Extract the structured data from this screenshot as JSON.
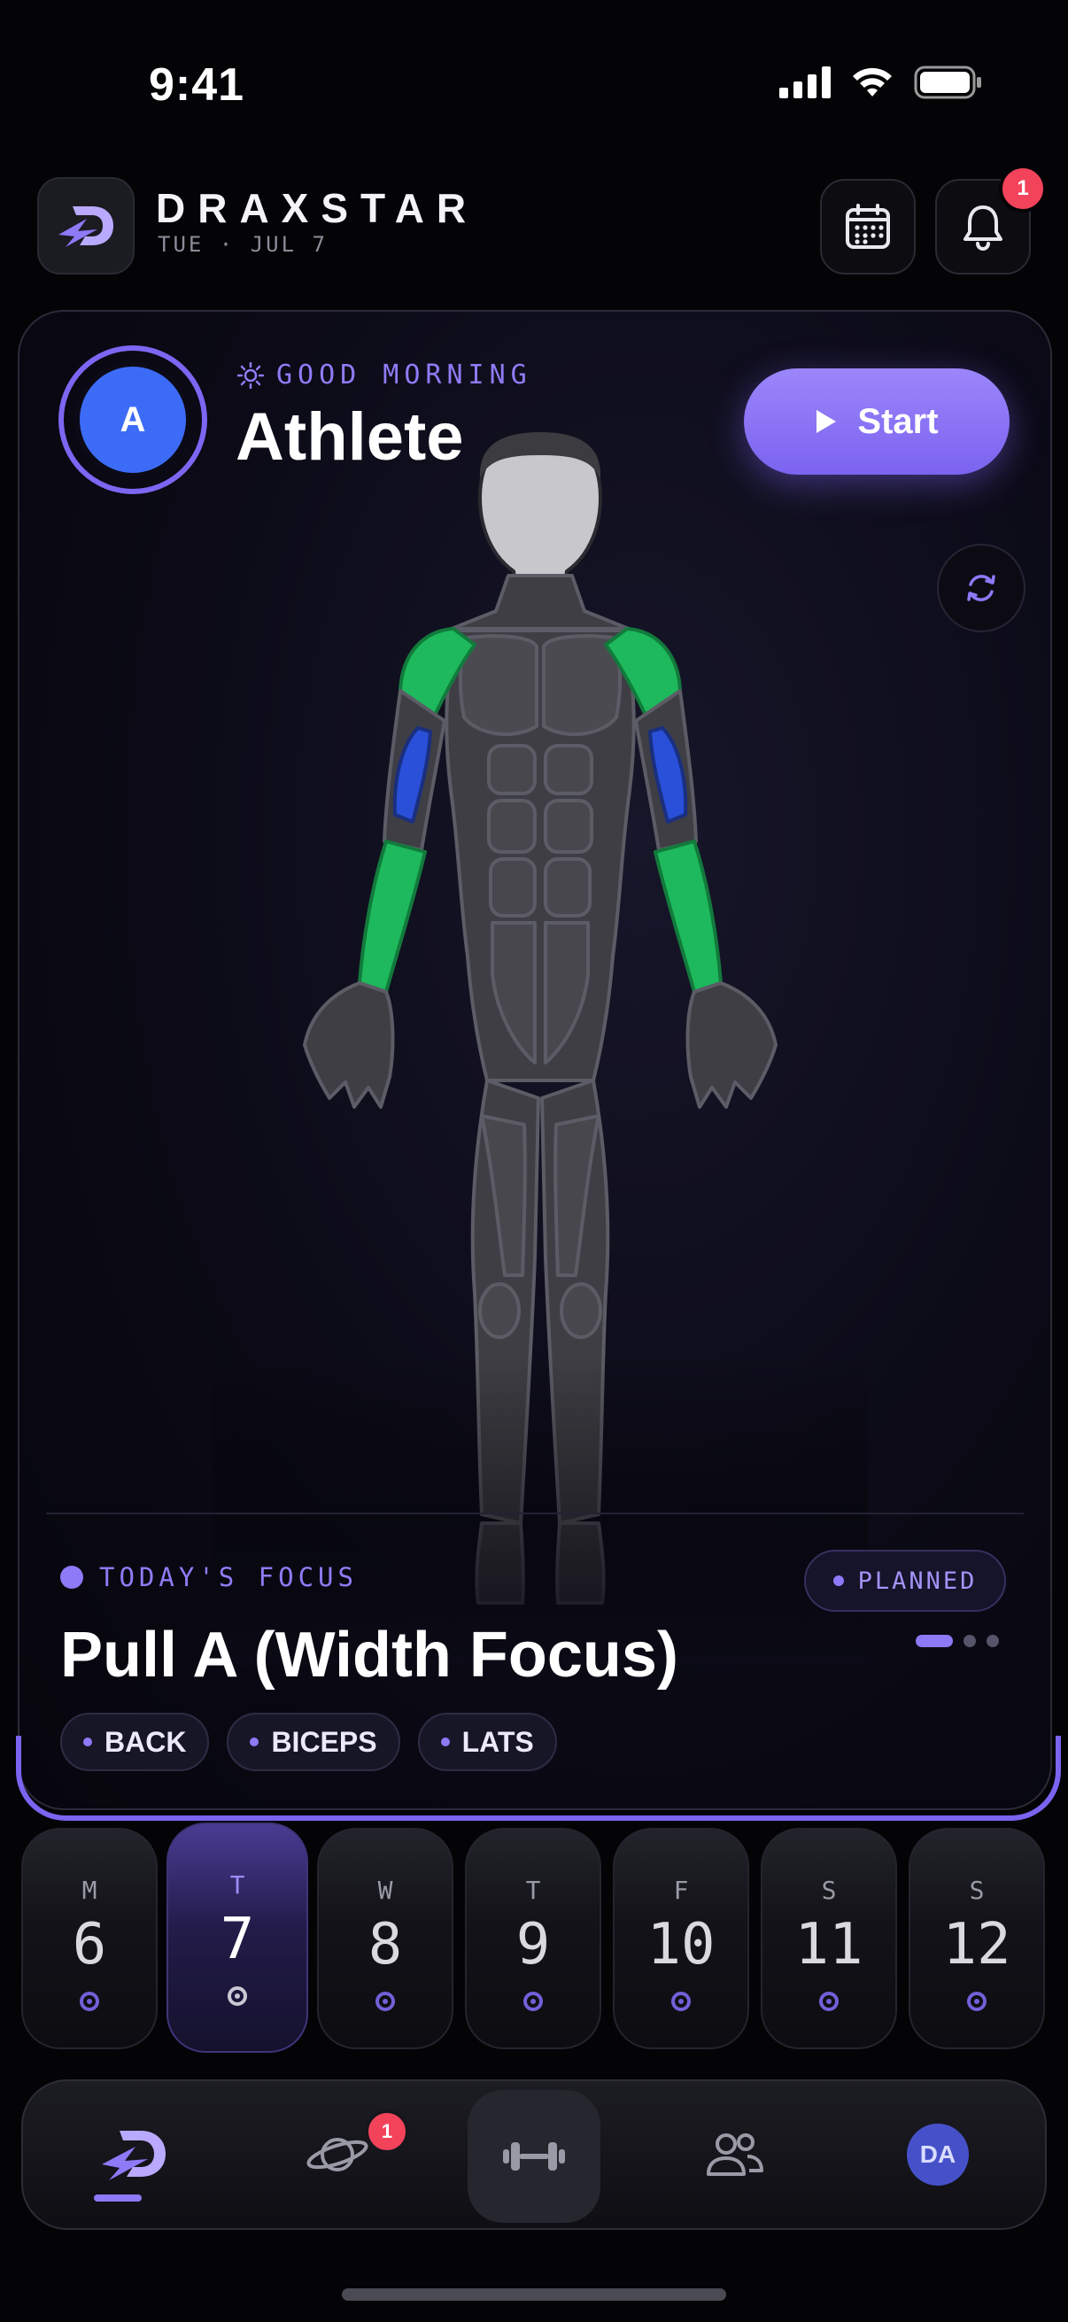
{
  "status_bar": {
    "time": "9:41"
  },
  "header": {
    "brand": "DRAXSTAR",
    "date": "TUE · JUL 7",
    "notification_count": "1",
    "icons": {
      "logo": "draxstar-logo-icon",
      "calendar": "calendar-icon",
      "bell": "bell-icon"
    }
  },
  "hero": {
    "avatar_initial": "A",
    "greeting": "GOOD MORNING",
    "name": "Athlete",
    "start_label": "Start",
    "focus_label": "TODAY'S FOCUS",
    "status_chip": "PLANNED",
    "workout_title": "Pull A (Width Focus)",
    "tags": [
      "BACK",
      "BICEPS",
      "LATS"
    ],
    "pager": {
      "count": 3,
      "active": 0
    },
    "highlighted_muscles": {
      "shoulders": "#1db95c",
      "forearms": "#1db95c",
      "biceps": "#2a4fd8"
    }
  },
  "week": [
    {
      "letter": "M",
      "num": "6"
    },
    {
      "letter": "T",
      "num": "7",
      "selected": true
    },
    {
      "letter": "W",
      "num": "8"
    },
    {
      "letter": "T",
      "num": "9"
    },
    {
      "letter": "F",
      "num": "10"
    },
    {
      "letter": "S",
      "num": "11"
    },
    {
      "letter": "S",
      "num": "12"
    }
  ],
  "tabbar": {
    "explore_badge": "1",
    "profile_initials": "DA",
    "icons": [
      "home-bolt-icon",
      "planet-icon",
      "dumbbell-icon",
      "people-icon",
      "profile-avatar"
    ]
  },
  "colors": {
    "accent": "#8e79f7",
    "badge": "#f2435a",
    "background": "#040407"
  }
}
